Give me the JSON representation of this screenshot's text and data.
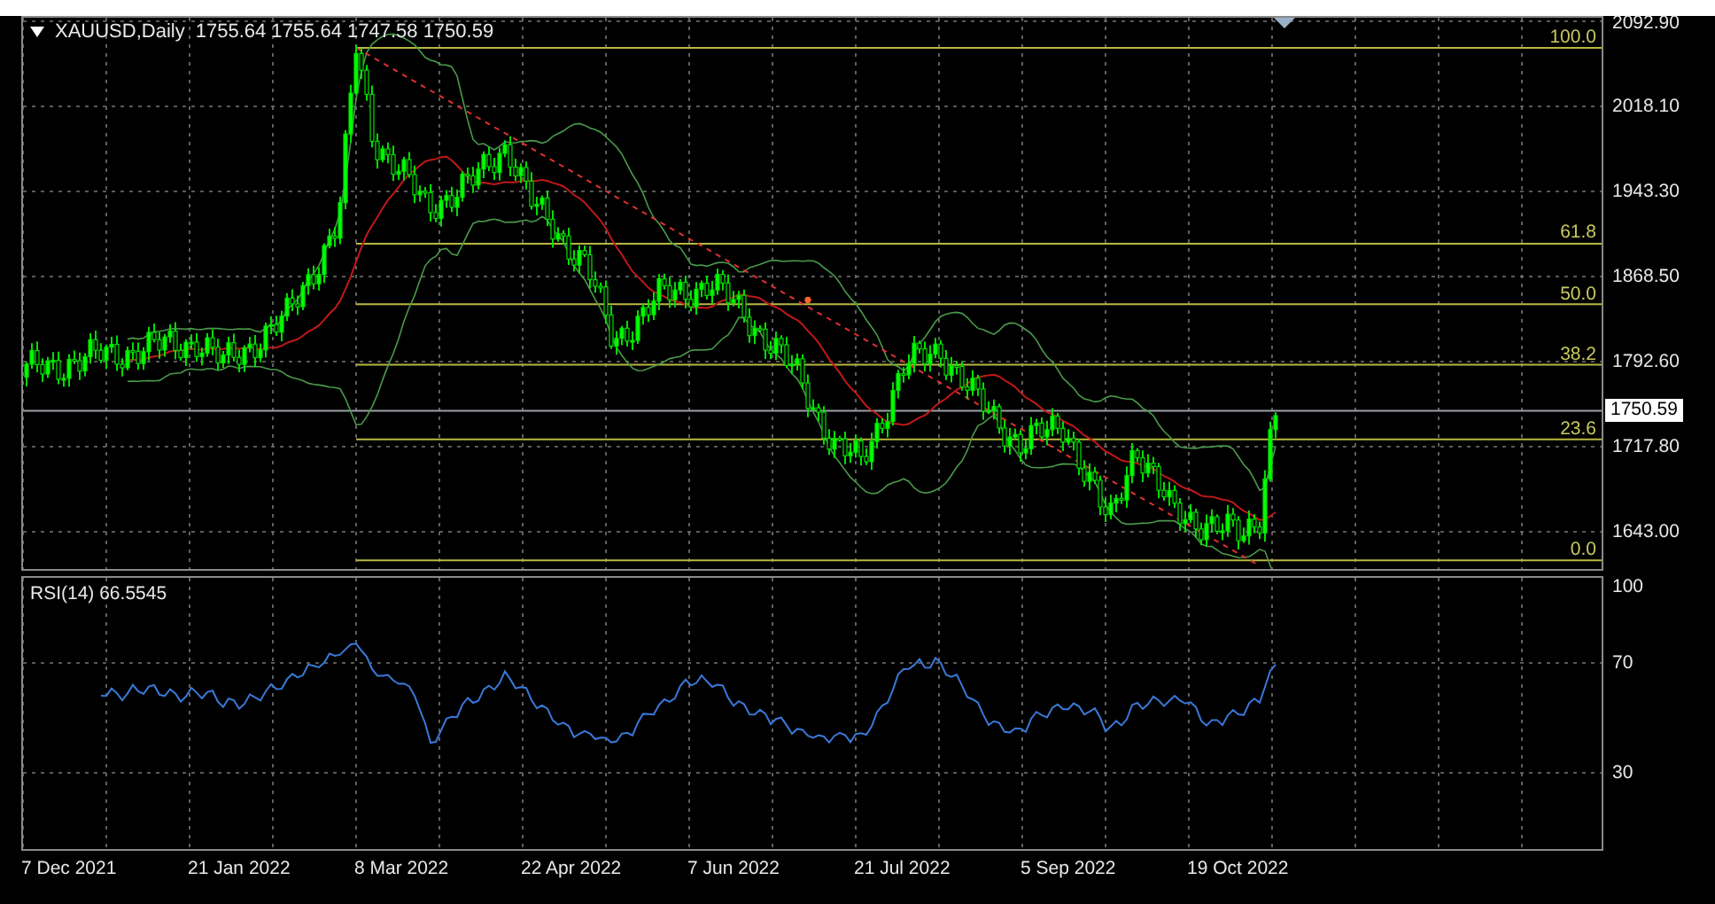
{
  "symbol_header": {
    "symbol": "XAUUSD,Daily",
    "ohlc": "1755.64 1755.64 1747.58 1750.59"
  },
  "fibonacci_levels": [
    {
      "label": "100.0"
    },
    {
      "label": "61.8"
    },
    {
      "label": "50.0"
    },
    {
      "label": "38.2"
    },
    {
      "label": "23.6"
    },
    {
      "label": "0.0"
    }
  ],
  "price_axis": {
    "ticks": [
      "2092.90",
      "2018.10",
      "1943.30",
      "1868.50",
      "1792.60",
      "1717.80",
      "1643.00"
    ],
    "current_price": "1750.59"
  },
  "rsi_panel": {
    "title": "RSI(14) 66.5545",
    "ticks": [
      "100",
      "70",
      "30"
    ]
  },
  "date_axis": {
    "labels": [
      "7 Dec 2021",
      "21 Jan 2022",
      "8 Mar 2022",
      "22 Apr 2022",
      "7 Jun 2022",
      "21 Jul 2022",
      "5 Sep 2022",
      "19 Oct 2022"
    ]
  }
}
